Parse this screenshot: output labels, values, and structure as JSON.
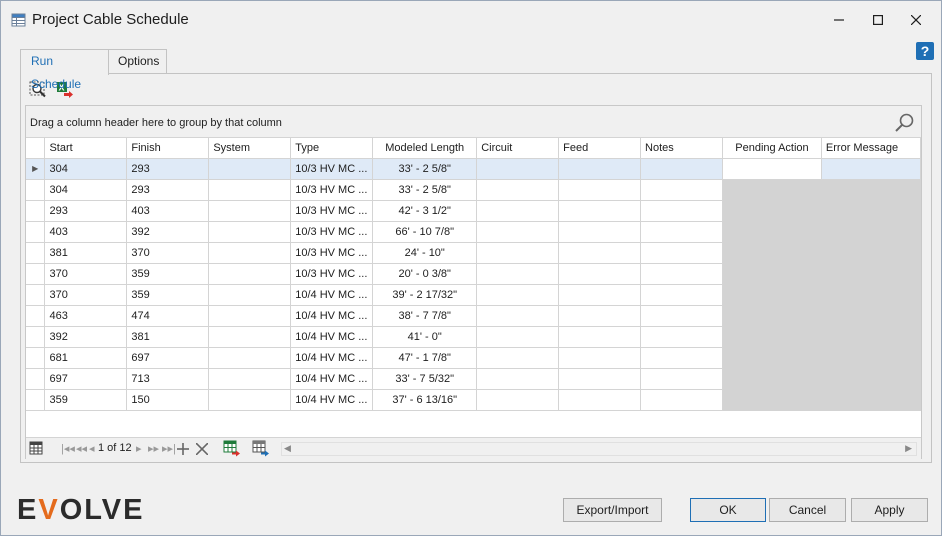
{
  "window": {
    "title": "Project Cable Schedule",
    "controls": [
      "minimize-icon",
      "maximize-icon",
      "close-icon"
    ],
    "help_label": "?"
  },
  "tabs": [
    {
      "label": "Run Schedule",
      "active": true
    },
    {
      "label": "Options",
      "active": false
    }
  ],
  "toolbar": {
    "icons": [
      "zoom-select-icon",
      "excel-export-icon"
    ]
  },
  "grid": {
    "group_hint": "Drag a column header here to group by that column",
    "columns": [
      "Start",
      "Finish",
      "System",
      "Type",
      "Modeled Length",
      "Circuit",
      "Feed",
      "Notes",
      "Pending Action",
      "Error Message"
    ],
    "rows": [
      [
        "304",
        "293",
        "",
        "10/3 HV MC ...",
        "33' - 2 5/8\"",
        "",
        "",
        "",
        "",
        ""
      ],
      [
        "304",
        "293",
        "",
        "10/3 HV MC ...",
        "33' - 2 5/8\"",
        "",
        "",
        "",
        "",
        ""
      ],
      [
        "293",
        "403",
        "",
        "10/3 HV MC ...",
        "42' - 3 1/2\"",
        "",
        "",
        "",
        "",
        ""
      ],
      [
        "403",
        "392",
        "",
        "10/3 HV MC ...",
        "66' - 10 7/8\"",
        "",
        "",
        "",
        "",
        ""
      ],
      [
        "381",
        "370",
        "",
        "10/3 HV MC ...",
        "24' - 10\"",
        "",
        "",
        "",
        "",
        ""
      ],
      [
        "370",
        "359",
        "",
        "10/3 HV MC ...",
        "20' - 0 3/8\"",
        "",
        "",
        "",
        "",
        ""
      ],
      [
        "370",
        "359",
        "",
        "10/4 HV MC ...",
        "39' - 2 17/32\"",
        "",
        "",
        "",
        "",
        ""
      ],
      [
        "463",
        "474",
        "",
        "10/4 HV MC ...",
        "38' - 7 7/8\"",
        "",
        "",
        "",
        "",
        ""
      ],
      [
        "392",
        "381",
        "",
        "10/4 HV MC ...",
        "41' - 0\"",
        "",
        "",
        "",
        "",
        ""
      ],
      [
        "681",
        "697",
        "",
        "10/4 HV MC ...",
        "47' - 1 7/8\"",
        "",
        "",
        "",
        "",
        ""
      ],
      [
        "697",
        "713",
        "",
        "10/4 HV MC ...",
        "33' - 7 5/32\"",
        "",
        "",
        "",
        "",
        ""
      ],
      [
        "359",
        "150",
        "",
        "10/4 HV MC ...",
        "37' - 6 13/16\"",
        "",
        "",
        "",
        "",
        ""
      ]
    ],
    "selected_row": 0
  },
  "navigator": {
    "page_text": "1 of 12",
    "icons": [
      "first-page-icon",
      "prev-page-icon",
      "prev-record-icon",
      "next-record-icon",
      "next-page-icon",
      "last-page-icon",
      "add-record-icon",
      "delete-record-icon"
    ]
  },
  "footer": {
    "logo_text": "EVOLVE",
    "export_import_label": "Export/Import",
    "ok_label": "OK",
    "cancel_label": "Cancel",
    "apply_label": "Apply"
  },
  "colors": {
    "accent": "#1f6fb5",
    "logo_accent": "#e46b1d",
    "selected_row": "#dfeaf7",
    "disabled_cell": "#d3d3d3"
  }
}
